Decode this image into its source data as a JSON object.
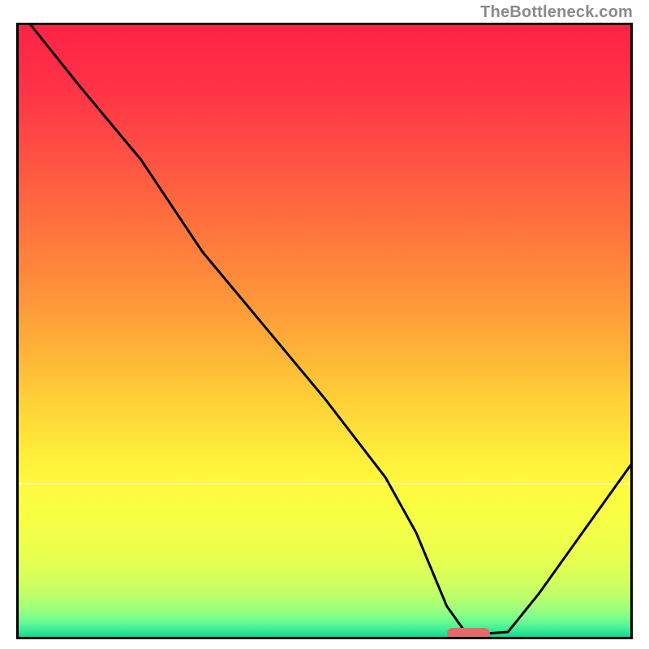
{
  "watermark": "TheBottleneck.com",
  "chart_data": {
    "type": "line",
    "title": "",
    "xlabel": "",
    "ylabel": "",
    "xlim": [
      0,
      100
    ],
    "ylim": [
      0,
      100
    ],
    "grid": false,
    "series": [
      {
        "name": "bottleneck-curve",
        "x": [
          2,
          10,
          20,
          30,
          40,
          50,
          60,
          65,
          70,
          73,
          76,
          80,
          85,
          90,
          95,
          100
        ],
        "values": [
          100,
          90,
          78,
          63,
          51,
          39,
          26,
          17,
          5,
          0.8,
          0.5,
          0.8,
          7,
          14,
          21,
          28
        ]
      }
    ],
    "annotations": [
      {
        "name": "optimal-marker",
        "x_start": 70,
        "x_end": 77,
        "y": 0.5
      }
    ],
    "gradient_bands": [
      {
        "stop": 0.0,
        "color": "#ff2345"
      },
      {
        "stop": 0.1,
        "color": "#ff3247"
      },
      {
        "stop": 0.2,
        "color": "#ff4d44"
      },
      {
        "stop": 0.3,
        "color": "#ff6a3f"
      },
      {
        "stop": 0.4,
        "color": "#ff873b"
      },
      {
        "stop": 0.45,
        "color": "#ff963a"
      },
      {
        "stop": 0.5,
        "color": "#ffa839"
      },
      {
        "stop": 0.55,
        "color": "#ffb938"
      },
      {
        "stop": 0.6,
        "color": "#ffcb38"
      },
      {
        "stop": 0.65,
        "color": "#ffdc39"
      },
      {
        "stop": 0.7,
        "color": "#ffed3b"
      },
      {
        "stop": 0.75,
        "color": "#fff93e"
      },
      {
        "stop": 0.8,
        "color": "#f8ff43"
      },
      {
        "stop": 0.84,
        "color": "#f0ff49"
      },
      {
        "stop": 0.88,
        "color": "#e4ff52"
      },
      {
        "stop": 0.91,
        "color": "#d2ff5e"
      },
      {
        "stop": 0.935,
        "color": "#baff6d"
      },
      {
        "stop": 0.955,
        "color": "#9cff7e"
      },
      {
        "stop": 0.97,
        "color": "#7aff8d"
      },
      {
        "stop": 0.982,
        "color": "#55f595"
      },
      {
        "stop": 0.992,
        "color": "#2fe697"
      },
      {
        "stop": 1.0,
        "color": "#12d894"
      }
    ]
  }
}
